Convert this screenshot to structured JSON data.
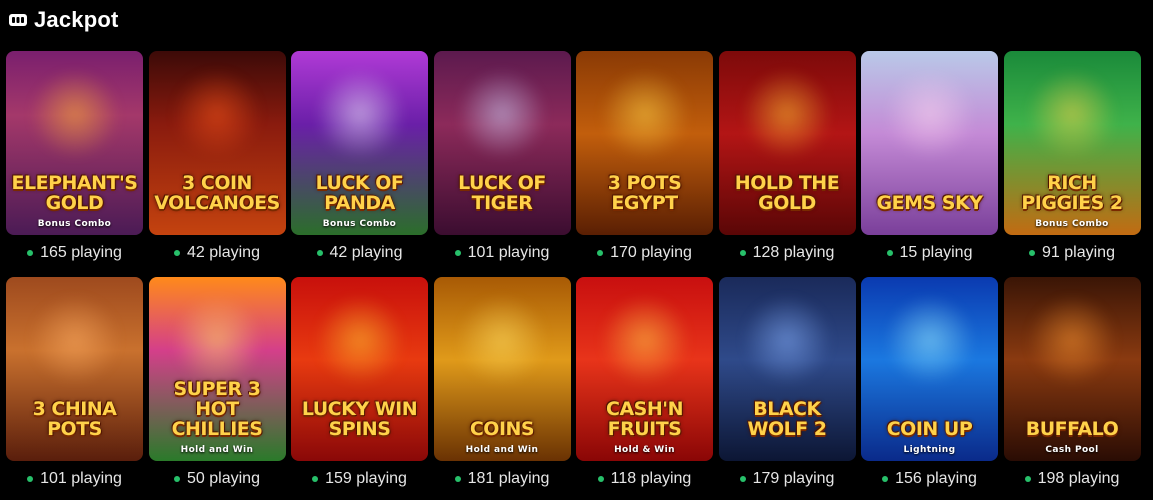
{
  "section": {
    "title": "Jackpot",
    "icon": "jackpot-machine-icon"
  },
  "games": [
    {
      "name": "Elephant's Gold",
      "sub": "Bonus Combo",
      "players": "165 playing",
      "bg": "linear-gradient(180deg,#7a1f6e 0%,#a4386a 35%,#4b1b55 100%)",
      "glow": "#ffb433"
    },
    {
      "name": "3 Coin Volcanoes",
      "sub": "",
      "players": "42 playing",
      "bg": "linear-gradient(180deg,#3c0a08 0%,#8a1b0e 40%,#c4430f 100%)",
      "glow": "#ff5a1a"
    },
    {
      "name": "Luck of Panda",
      "sub": "Bonus Combo",
      "players": "42 playing",
      "bg": "linear-gradient(180deg,#b03ad6 0%,#6a1fa8 40%,#2b6e2a 100%)",
      "glow": "#f5f5ff"
    },
    {
      "name": "Luck of Tiger",
      "sub": "",
      "players": "101 playing",
      "bg": "linear-gradient(180deg,#5c1a4e 0%,#8c2a5a 40%,#3b0d30 100%)",
      "glow": "#cfd8ff"
    },
    {
      "name": "3 Pots Egypt",
      "sub": "",
      "players": "170 playing",
      "bg": "linear-gradient(180deg,#8a3a05 0%,#c25e0c 45%,#5a1f03 100%)",
      "glow": "#ffd84a"
    },
    {
      "name": "Hold the Gold",
      "sub": "",
      "players": "128 playing",
      "bg": "linear-gradient(180deg,#7d0a0a 0%,#b31515 45%,#5a0606 100%)",
      "glow": "#ffcc33"
    },
    {
      "name": "Gems Sky",
      "sub": "",
      "players": "15 playing",
      "bg": "linear-gradient(180deg,#b9c9e8 0%,#c48ad6 45%,#7a3f9a 100%)",
      "glow": "#ffd6f0"
    },
    {
      "name": "Rich Piggies 2",
      "sub": "Bonus Combo",
      "players": "91 playing",
      "bg": "linear-gradient(180deg,#1a8a3a 0%,#3fb24a 40%,#c26b12 100%)",
      "glow": "#ffd24a"
    },
    {
      "name": "3 China Pots",
      "sub": "",
      "players": "101 playing",
      "bg": "linear-gradient(180deg,#9e4a1e 0%,#c9712e 40%,#5a1e0c 100%)",
      "glow": "#ffb066"
    },
    {
      "name": "Super 3 Hot Chillies",
      "sub": "Hold and Win",
      "players": "50 playing",
      "bg": "linear-gradient(180deg,#ff8a1a 0%,#d43f8a 40%,#2a7a2a 100%)",
      "glow": "#ffe066"
    },
    {
      "name": "Lucky Win Spins",
      "sub": "",
      "players": "159 playing",
      "bg": "linear-gradient(180deg,#c8100c 0%,#e83a10 45%,#8a0808 100%)",
      "glow": "#ffcc33"
    },
    {
      "name": "Coins",
      "sub": "Hold and Win",
      "players": "181 playing",
      "bg": "linear-gradient(180deg,#a85a05 0%,#e09a1a 45%,#6a3203 100%)",
      "glow": "#ffe066"
    },
    {
      "name": "Cash'n Fruits",
      "sub": "Hold & Win",
      "players": "118 playing",
      "bg": "linear-gradient(180deg,#c80f0f 0%,#e8341a 45%,#8a0606 100%)",
      "glow": "#ffd24a"
    },
    {
      "name": "Black Wolf 2",
      "sub": "",
      "players": "179 playing",
      "bg": "linear-gradient(180deg,#1a2a5a 0%,#2f4a8a 45%,#0c1634 100%)",
      "glow": "#8ab4ff"
    },
    {
      "name": "Coin Up",
      "sub": "Lightning",
      "players": "156 playing",
      "bg": "linear-gradient(180deg,#0a3ab0 0%,#1b78e0 45%,#0a2a8a 100%)",
      "glow": "#9ff0ff"
    },
    {
      "name": "Buffalo",
      "sub": "Cash Pool",
      "players": "198 playing",
      "bg": "linear-gradient(180deg,#3a1506 0%,#8a3a10 45%,#2a0c04 100%)",
      "glow": "#ff9a33"
    }
  ]
}
